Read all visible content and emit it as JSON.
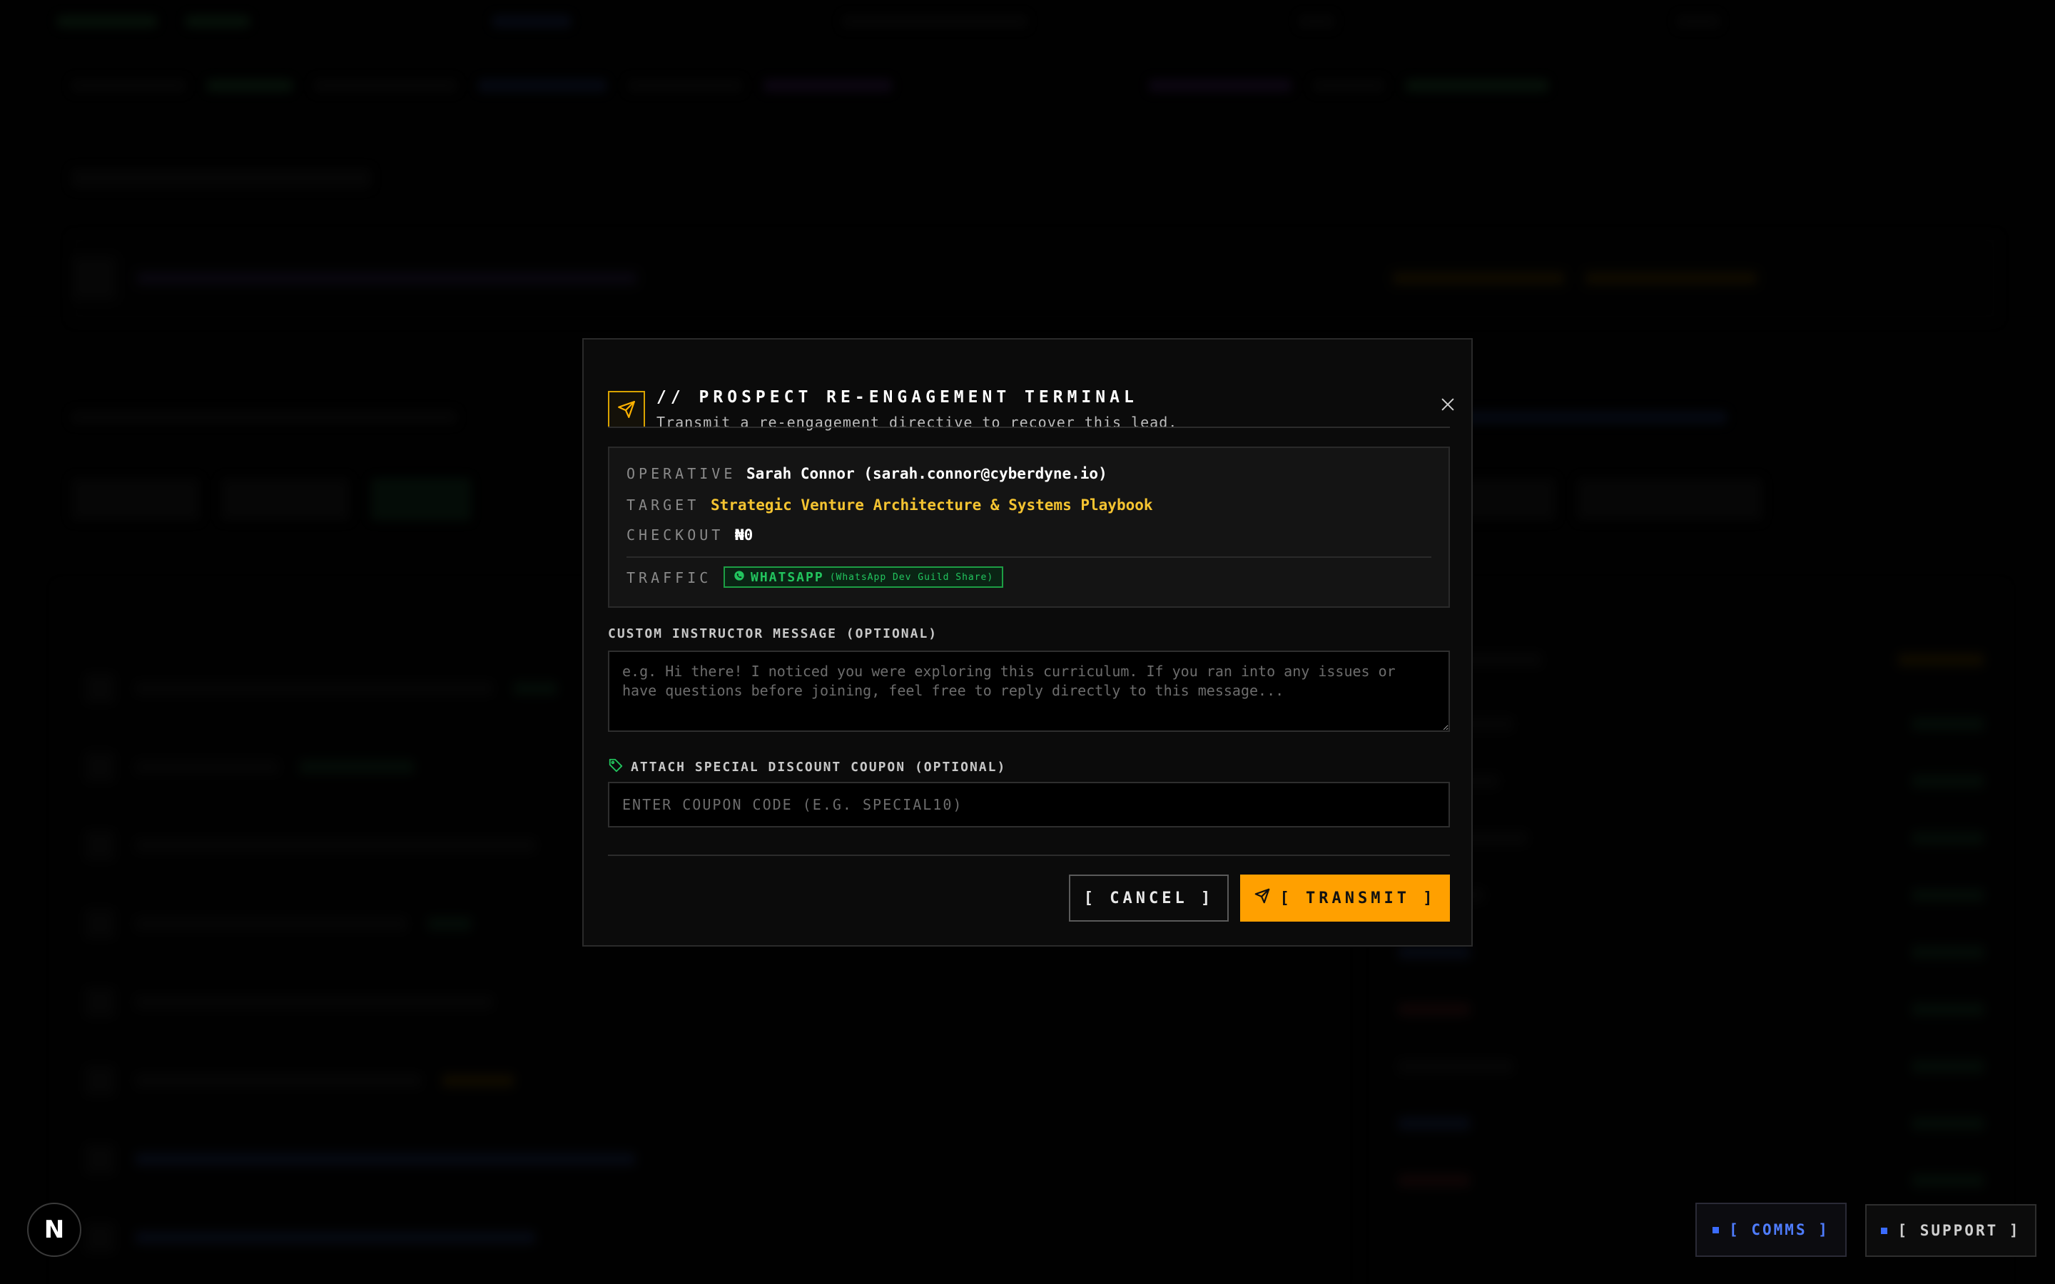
{
  "modal": {
    "title": "// PROSPECT RE-ENGAGEMENT TERMINAL",
    "subtitle": "Transmit a re-engagement directive to recover this lead.",
    "info": {
      "operative_label": "OPERATIVE",
      "operative_value": "Sarah Connor (sarah.connor@cyberdyne.io)",
      "target_label": "TARGET",
      "target_value": "Strategic Venture Architecture & Systems Playbook",
      "checkout_label": "CHECKOUT",
      "checkout_value": "₦0",
      "traffic_label": "TRAFFIC",
      "traffic_source": "WHATSAPP",
      "traffic_detail": "(WhatsApp Dev Guild Share)"
    },
    "message": {
      "label": "CUSTOM INSTRUCTOR MESSAGE (OPTIONAL)",
      "value": "",
      "placeholder": "e.g. Hi there! I noticed you were exploring this curriculum. If you ran into any issues or have questions before joining, feel free to reply directly to this message..."
    },
    "coupon": {
      "label": "ATTACH SPECIAL DISCOUNT COUPON (OPTIONAL)",
      "value": "",
      "placeholder": "ENTER COUPON CODE (E.G. SPECIAL10)"
    },
    "cancel_label": "[ CANCEL ]",
    "transmit_label": "[ TRANSMIT ]"
  },
  "widgets": {
    "n_badge": "N",
    "comms_label": "[ COMMS ]",
    "support_label": "[ SUPPORT ]"
  },
  "colors": {
    "accent": "#ffa000",
    "target_text": "#f5c431",
    "whatsapp": "#22c55e",
    "comms": "#4f7dff"
  },
  "icons": {
    "header": "send-icon",
    "close": "close-icon",
    "whatsapp": "whatsapp-icon",
    "coupon": "tag-icon",
    "transmit": "send-icon"
  }
}
